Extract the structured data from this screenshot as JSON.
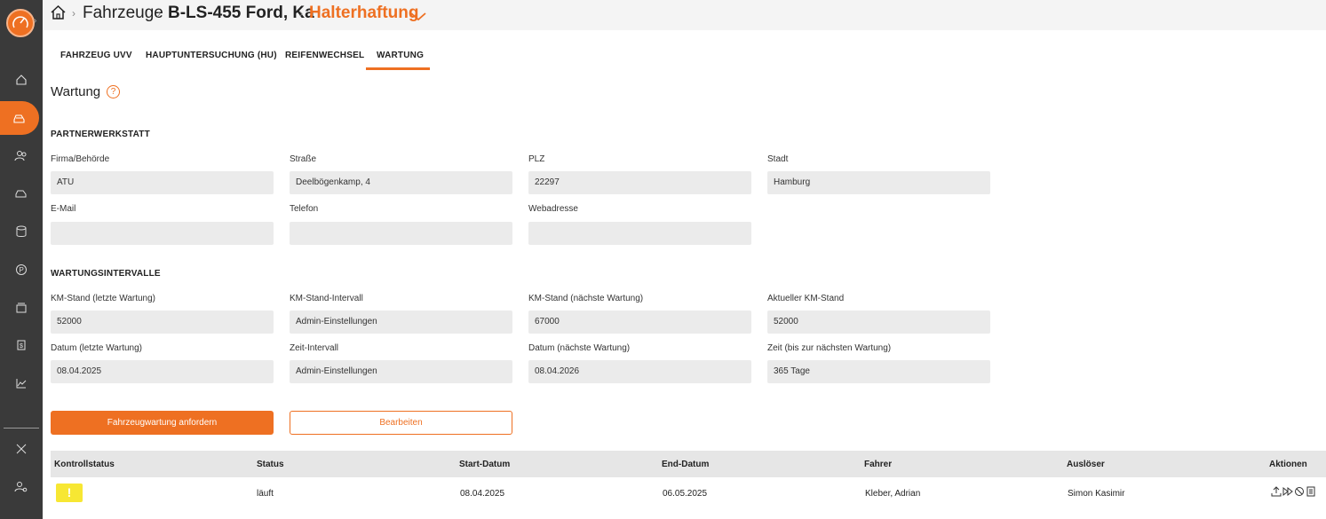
{
  "breadcrumb": {
    "items": [
      "Fahrzeuge",
      "B-LS-455 Ford, Ka"
    ],
    "current": "Halterhaftung"
  },
  "tabs": [
    {
      "label": "FAHRZEUG UVV"
    },
    {
      "label": "HAUPTUNTERSUCHUNG (HU)"
    },
    {
      "label": "REIFENWECHSEL"
    },
    {
      "label": "WARTUNG"
    }
  ],
  "active_tab": "WARTUNG",
  "section": {
    "title": "Wartung",
    "help": "?"
  },
  "partner": {
    "title": "PARTNERWERKSTATT",
    "fields": [
      {
        "label": "Firma/Behörde",
        "value": "ATU"
      },
      {
        "label": "Straße",
        "value": "Deelbögenkamp, 4"
      },
      {
        "label": "PLZ",
        "value": "22297"
      },
      {
        "label": "Stadt",
        "value": "Hamburg"
      },
      {
        "label": "E-Mail",
        "value": ""
      },
      {
        "label": "Telefon",
        "value": ""
      },
      {
        "label": "Webadresse",
        "value": ""
      }
    ]
  },
  "intervals": {
    "title": "WARTUNGSINTERVALLE",
    "fields": [
      {
        "label": "KM-Stand (letzte Wartung)",
        "value": "52000"
      },
      {
        "label": "KM-Stand-Intervall",
        "value": "Admin-Einstellungen"
      },
      {
        "label": "KM-Stand (nächste Wartung)",
        "value": "67000"
      },
      {
        "label": "Aktueller KM-Stand",
        "value": "52000"
      },
      {
        "label": "Datum (letzte Wartung)",
        "value": "08.04.2025"
      },
      {
        "label": "Zeit-Intervall",
        "value": "Admin-Einstellungen"
      },
      {
        "label": "Datum (nächste Wartung)",
        "value": "08.04.2026"
      },
      {
        "label": "Zeit (bis zur nächsten Wartung)",
        "value": "365 Tage"
      }
    ]
  },
  "buttons": {
    "request": "Fahrzeugwartung anfordern",
    "edit": "Bearbeiten"
  },
  "table": {
    "headers": [
      "Kontrollstatus",
      "Status",
      "Start-Datum",
      "End-Datum",
      "Fahrer",
      "Auslöser",
      "Aktionen"
    ],
    "rows": [
      {
        "kontrollstatus": "!",
        "status": "läuft",
        "start": "08.04.2025",
        "end": "06.05.2025",
        "fahrer": "Kleber, Adrian",
        "ausloeser": "Simon Kasimir"
      }
    ]
  },
  "colors": {
    "accent": "#ee7022",
    "sidebar": "#3a3a3a",
    "warning": "#f7e733"
  }
}
